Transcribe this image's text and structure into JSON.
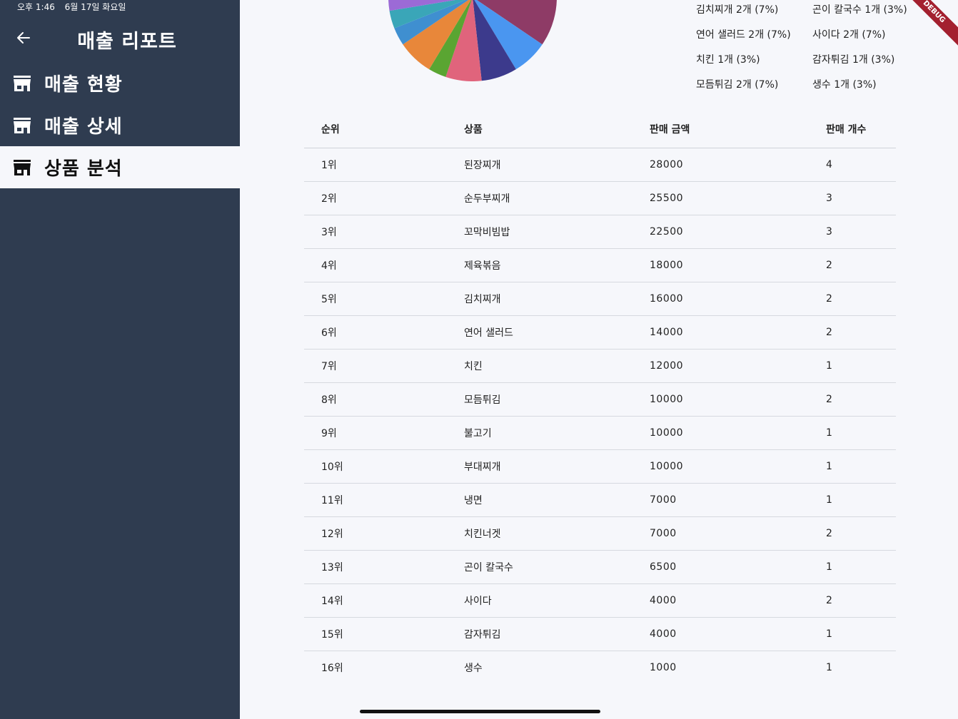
{
  "status_bar": {
    "time": "오후 1:46",
    "date": "6월 17일 화요일"
  },
  "sidebar": {
    "title": "매출 리포트",
    "items": [
      {
        "label": "매출 현황",
        "icon": "store-icon",
        "active": false
      },
      {
        "label": "매출 상세",
        "icon": "store-icon",
        "active": false
      },
      {
        "label": "상품 분석",
        "icon": "store-icon",
        "active": true
      }
    ]
  },
  "debug_banner": "DEBUG",
  "chart_data": {
    "type": "pie",
    "slices": [
      {
        "label": "된장찌개",
        "count": 4,
        "color": "#36506b"
      },
      {
        "label": "순두부찌개",
        "count": 3,
        "color": "#f6b73c"
      },
      {
        "label": "꼬막비빔밥",
        "count": 3,
        "color": "#8e3b66"
      },
      {
        "label": "제육볶음",
        "count": 2,
        "color": "#4a96f0"
      },
      {
        "label": "김치찌개",
        "count": 2,
        "color": "#3c3a8c"
      },
      {
        "label": "연어 샐러드",
        "count": 2,
        "color": "#e0647c"
      },
      {
        "label": "치킨",
        "count": 1,
        "color": "#5aa532"
      },
      {
        "label": "모듬튀김",
        "count": 2,
        "color": "#e8873a"
      },
      {
        "label": "불고기",
        "count": 1,
        "color": "#3f8fd0"
      },
      {
        "label": "부대찌개",
        "count": 1,
        "color": "#3aa6b8"
      },
      {
        "label": "냉면",
        "count": 1,
        "color": "#9c6ad6"
      },
      {
        "label": "치킨너겟",
        "count": 2,
        "color": "#f2c649"
      },
      {
        "label": "곤이 칼국수",
        "count": 1,
        "color": "#b44f8e"
      },
      {
        "label": "사이다",
        "count": 2,
        "color": "#63c089"
      },
      {
        "label": "감자튀김",
        "count": 1,
        "color": "#d9534f"
      },
      {
        "label": "생수",
        "count": 1,
        "color": "#7a8da3"
      }
    ]
  },
  "legend": [
    {
      "text": "김치찌개 2개 (7%)"
    },
    {
      "text": "곤이 칼국수 1개 (3%)"
    },
    {
      "text": "연어 샐러드 2개 (7%)"
    },
    {
      "text": "사이다 2개 (7%)"
    },
    {
      "text": "치킨 1개 (3%)"
    },
    {
      "text": "감자튀김 1개 (3%)"
    },
    {
      "text": "모듬튀김 2개 (7%)"
    },
    {
      "text": "생수 1개 (3%)"
    }
  ],
  "table": {
    "headers": [
      "순위",
      "상품",
      "판매 금액",
      "판매 개수"
    ],
    "rows": [
      [
        "1위",
        "된장찌개",
        "28000",
        "4"
      ],
      [
        "2위",
        "순두부찌개",
        "25500",
        "3"
      ],
      [
        "3위",
        "꼬막비빔밥",
        "22500",
        "3"
      ],
      [
        "4위",
        "제육볶음",
        "18000",
        "2"
      ],
      [
        "5위",
        "김치찌개",
        "16000",
        "2"
      ],
      [
        "6위",
        "연어 샐러드",
        "14000",
        "2"
      ],
      [
        "7위",
        "치킨",
        "12000",
        "1"
      ],
      [
        "8위",
        "모듬튀김",
        "10000",
        "2"
      ],
      [
        "9위",
        "불고기",
        "10000",
        "1"
      ],
      [
        "10위",
        "부대찌개",
        "10000",
        "1"
      ],
      [
        "11위",
        "냉면",
        "7000",
        "1"
      ],
      [
        "12위",
        "치킨너겟",
        "7000",
        "2"
      ],
      [
        "13위",
        "곤이 칼국수",
        "6500",
        "1"
      ],
      [
        "14위",
        "사이다",
        "4000",
        "2"
      ],
      [
        "15위",
        "감자튀김",
        "4000",
        "1"
      ],
      [
        "16위",
        "생수",
        "1000",
        "1"
      ]
    ]
  }
}
